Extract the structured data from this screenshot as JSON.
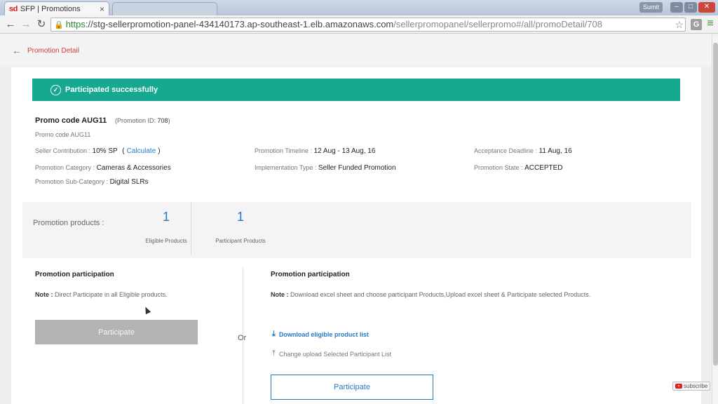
{
  "browser": {
    "tab_title": "SFP | Promotions",
    "tab_favicon_text": "sd",
    "tab_close": "×",
    "user_name": "Sumit",
    "url_https": "https",
    "url_host": "://stg-sellerpromotion-panel-434140173.ap-southeast-1.elb.amazonaws.com",
    "url_path": "/sellerpromopanel/sellerpromo#/all/promoDetail/708",
    "extension_label": "G",
    "icons": {
      "back": "arrow-left-icon",
      "forward": "arrow-right-icon",
      "reload": "reload-icon",
      "lock": "lock-icon",
      "bookmark": "star-icon",
      "menu": "hamburger-menu-icon"
    }
  },
  "header": {
    "title": "Promotion Detail"
  },
  "banner": {
    "text": "Participated successfully",
    "color": "#17a891"
  },
  "promo": {
    "code": "Promo code AUG11",
    "id_label": "(Promotion ID:",
    "id_value": "708",
    "id_close": ")",
    "description": "Promo code AUG11",
    "details": {
      "seller_contribution_label": "Seller Contribution :",
      "seller_contribution_value": "10% SP",
      "calculate_open": "(",
      "calculate_link": "Calculate",
      "calculate_close": ")",
      "timeline_label": "Promotion Timeline :",
      "timeline_value": "12 Aug - 13 Aug, 16",
      "deadline_label": "Acceptance Deadline :",
      "deadline_value": "11 Aug, 16",
      "category_label": "Promotion Category :",
      "category_value": "Cameras & Accessories",
      "implementation_label": "Implementation Type :",
      "implementation_value": "Seller Funded Promotion",
      "state_label": "Promotion State :",
      "state_value": "ACCEPTED",
      "subcategory_label": "Promotion Sub-Category :",
      "subcategory_value": "Digital SLRs"
    }
  },
  "summary": {
    "label": "Promotion products :",
    "eligible_count": "1",
    "eligible_label": "Eligible Products",
    "participant_count": "1",
    "participant_label": "Participant Products"
  },
  "left_panel": {
    "title": "Promotion participation",
    "note_label": "Note :",
    "note_text": "Direct Participate in all Eligible products.",
    "button": "Participate"
  },
  "or_label": "Or",
  "right_panel": {
    "title": "Promotion participation",
    "note_label": "Note :",
    "note_text": "Download excel sheet and choose participant Products,Upload excel sheet & Participate selected Products.",
    "download_link": "Download eligible product list",
    "upload_link": "Change upload Selected Participant List",
    "button": "Participate"
  },
  "overlay": {
    "subscribe": "subscribe"
  },
  "colors": {
    "accent": "#2478c8",
    "title_red": "#d23c3c",
    "disabled": "#b3b3b3"
  }
}
